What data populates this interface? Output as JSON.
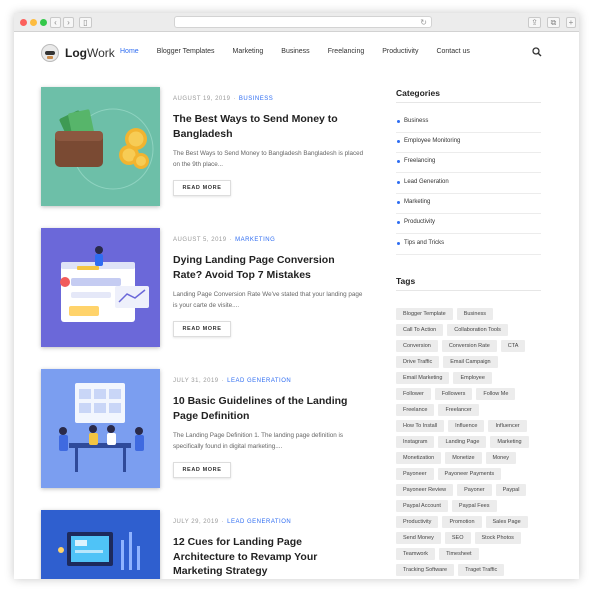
{
  "site": {
    "logo_bold": "Log",
    "logo_light": "Work",
    "nav": [
      {
        "label": "Home"
      },
      {
        "label": "Blogger Templates"
      },
      {
        "label": "Marketing"
      },
      {
        "label": "Business"
      },
      {
        "label": "Freelancing"
      },
      {
        "label": "Productivity"
      },
      {
        "label": "Contact us"
      }
    ]
  },
  "posts": [
    {
      "date": "AUGUST 19, 2019",
      "category": "BUSINESS",
      "title": "The Best Ways to Send Money to Bangladesh",
      "excerpt": "The Best Ways to Send Money to Bangladesh Bangladesh is placed on the 9th place...",
      "read_more": "READ MORE",
      "thumb_color": "#6dbfa8"
    },
    {
      "date": "AUGUST 5, 2019",
      "category": "MARKETING",
      "title": "Dying Landing Page Conversion Rate? Avoid Top 7 Mistakes",
      "excerpt": "Landing Page Conversion Rate We've stated that your landing page is your carte de visite....",
      "read_more": "READ MORE",
      "thumb_color": "#6b68d9"
    },
    {
      "date": "JULY 31, 2019",
      "category": "LEAD GENERATION",
      "title": "10 Basic Guidelines of the Landing Page Definition",
      "excerpt": "The Landing Page Definition 1. The landing page definition is specifically found in digital marketing....",
      "read_more": "READ MORE",
      "thumb_color": "#7b9ef0"
    },
    {
      "date": "JULY 29, 2019",
      "category": "LEAD GENERATION",
      "title": "12 Cues for Landing Page Architecture to Revamp Your Marketing Strategy",
      "thumb_color": "#2f5fcf"
    }
  ],
  "sidebar": {
    "categories_title": "Categories",
    "categories": [
      {
        "label": "Business"
      },
      {
        "label": "Employee Monitoring"
      },
      {
        "label": "Freelancing"
      },
      {
        "label": "Lead Generation"
      },
      {
        "label": "Marketing"
      },
      {
        "label": "Productivity"
      },
      {
        "label": "Tips and Tricks"
      }
    ],
    "tags_title": "Tags",
    "tag_rows": [
      [
        "Blogger Template",
        "Business"
      ],
      [
        "Call To Action",
        "Collaboration Tools"
      ],
      [
        "Conversion",
        "Conversion Rate",
        "CTA"
      ],
      [
        "Drive Traffic",
        "Email Campaign"
      ],
      [
        "Email Marketing",
        "Employee"
      ],
      [
        "Follower",
        "Followers",
        "Follow Me"
      ],
      [
        "Freelance",
        "Freelancer"
      ],
      [
        "How To Install",
        "Influence",
        "Influencer"
      ],
      [
        "Instagram",
        "Landing Page",
        "Marketing"
      ],
      [
        "Monetization",
        "Monetize",
        "Money"
      ],
      [
        "Payoneer",
        "Payoneer Payments"
      ],
      [
        "Payoneer Review",
        "Payoner",
        "Paypal"
      ],
      [
        "Paypal Account",
        "Paypal Fees"
      ],
      [
        "Productivity",
        "Promotion",
        "Sales Page"
      ],
      [
        "Send Money",
        "SEO",
        "Stock Photos"
      ],
      [
        "Teamwork",
        "Timesheet"
      ],
      [
        "Tracking Software",
        "Traget Traffic"
      ]
    ]
  }
}
